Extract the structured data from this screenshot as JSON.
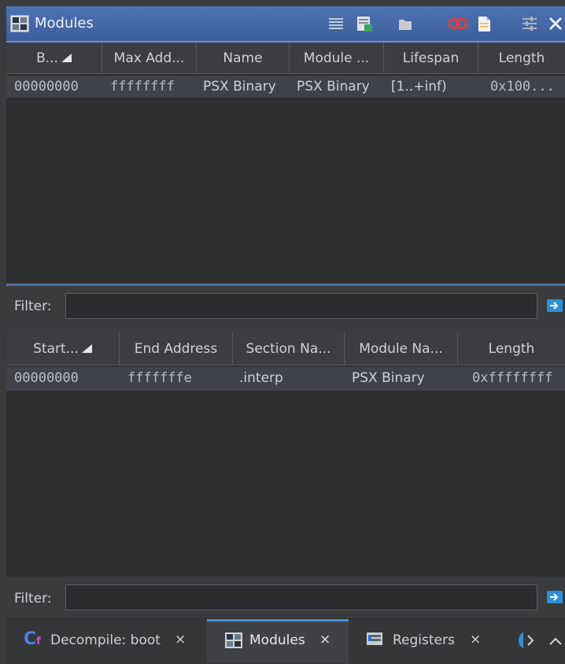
{
  "title": "Modules",
  "modules_table": {
    "columns": [
      "B...",
      "Max Add...",
      "Name",
      "Module ...",
      "Lifespan",
      "Length"
    ],
    "rows": [
      {
        "base": "00000000",
        "max": "ffffffff",
        "name": "PSX Binary",
        "module": "PSX Binary",
        "lifespan": "[1..+inf)",
        "length": "0x100..."
      }
    ]
  },
  "sections_table": {
    "columns": [
      "Start...",
      "End Address",
      "Section Na...",
      "Module Na...",
      "Length"
    ],
    "rows": [
      {
        "start": "00000000",
        "end": "fffffffe",
        "section": ".interp",
        "module": "PSX Binary",
        "length": "0xffffffff"
      }
    ]
  },
  "filter_label": "Filter:",
  "divider_label": "•••",
  "bottom_tabs": [
    {
      "label": "Decompile: boot",
      "icon": "decompile-icon"
    },
    {
      "label": "Modules",
      "icon": "modules-icon"
    },
    {
      "label": "Registers",
      "icon": "registers-icon"
    }
  ],
  "colors": {
    "accent": "#4a90d9",
    "background": "#2e2f31",
    "selected_row": "#3f4248"
  }
}
